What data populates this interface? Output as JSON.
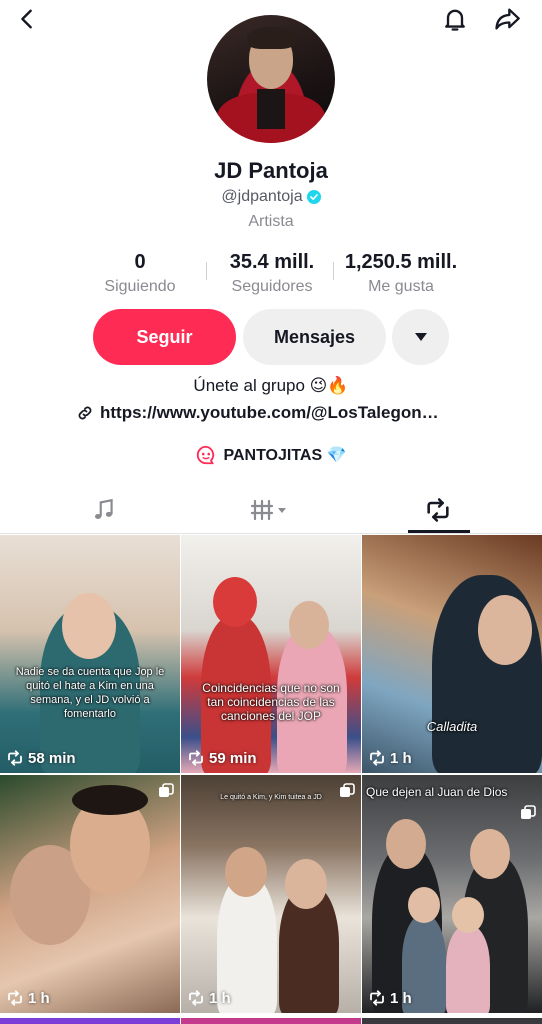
{
  "profile": {
    "name": "JD Pantoja",
    "handle": "@jdpantoja",
    "category": "Artista",
    "verified": true
  },
  "stats": [
    {
      "value": "0",
      "label": "Siguiendo"
    },
    {
      "value": "35.4 mill.",
      "label": "Seguidores"
    },
    {
      "value": "1,250.5 mill.",
      "label": "Me gusta"
    }
  ],
  "actions": {
    "follow_label": "Seguir",
    "message_label": "Mensajes"
  },
  "bio": {
    "line": "Únete al grupo 😉🔥",
    "link": "https://www.youtube.com/@LosTalegon…",
    "group": "PANTOJITAS 💎"
  },
  "tabs": [
    {
      "icon": "music-note-icon"
    },
    {
      "icon": "grid-dropdown-icon"
    },
    {
      "icon": "repost-icon",
      "active": true
    }
  ],
  "videos": [
    {
      "caption": "Nadie se da cuenta que Jop le quitó el hate a Kim en una semana, y el JD volvió a fomentarlo",
      "time": "58 min",
      "multi": false
    },
    {
      "caption": "Coincidencias que no son tan coincidencias de las canciones del JOP",
      "time": "59 min",
      "multi": false
    },
    {
      "caption": "Calladita",
      "time": "1 h",
      "multi": false
    },
    {
      "caption": "",
      "time": "1 h",
      "multi": true
    },
    {
      "caption": "Le quitó a Kim, y Kim tuitea a JD",
      "time": "1 h",
      "multi": true
    },
    {
      "caption": "Que dejen al Juan de Dios",
      "time": "1 h",
      "multi": true
    }
  ],
  "colors": {
    "accent": "#fe2c55",
    "verified": "#20d5ec",
    "secondary_button": "#efeff0"
  }
}
